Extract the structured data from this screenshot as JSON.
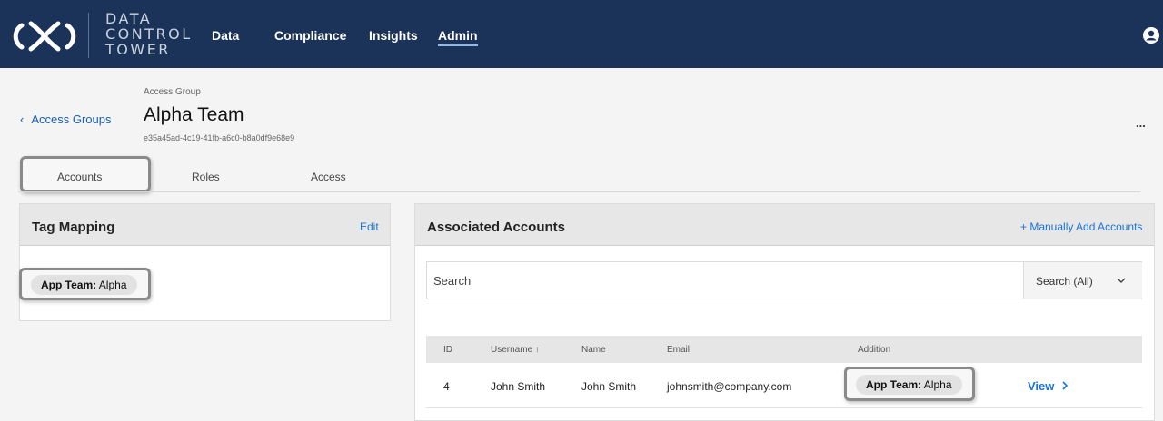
{
  "header": {
    "logo_lines": [
      "DATA",
      "CONTROL",
      "TOWER"
    ],
    "nav": [
      {
        "label": "Data"
      },
      {
        "label": "Compliance"
      },
      {
        "label": "Insights"
      },
      {
        "label": "Admin",
        "active": true
      }
    ]
  },
  "page": {
    "back_label": "Access Groups",
    "eyebrow": "Access Group",
    "title": "Alpha Team",
    "uuid": "e35a45ad-4c19-41fb-a6c0-b8a0df9e68e9",
    "more_label": "..."
  },
  "tabs": [
    {
      "label": "Accounts",
      "active": true
    },
    {
      "label": "Roles"
    },
    {
      "label": "Access"
    }
  ],
  "tag_mapping": {
    "title": "Tag Mapping",
    "edit_label": "Edit",
    "tag_key": "App Team:",
    "tag_value": " Alpha"
  },
  "associated": {
    "title": "Associated Accounts",
    "add_label": "+ Manually Add Accounts",
    "search_placeholder": "Search",
    "search_scope": "Search (All)",
    "columns": [
      "ID",
      "Username ↑",
      "Name",
      "Email",
      "Addition"
    ],
    "rows": [
      {
        "id": "4",
        "username": "John Smith",
        "name": "John Smith",
        "email": "johnsmith@company.com",
        "addition_key": "App Team:",
        "addition_value": " Alpha",
        "view_label": "View"
      }
    ]
  },
  "colors": {
    "header_bg": "#1b3358",
    "link": "#1a73d9"
  }
}
